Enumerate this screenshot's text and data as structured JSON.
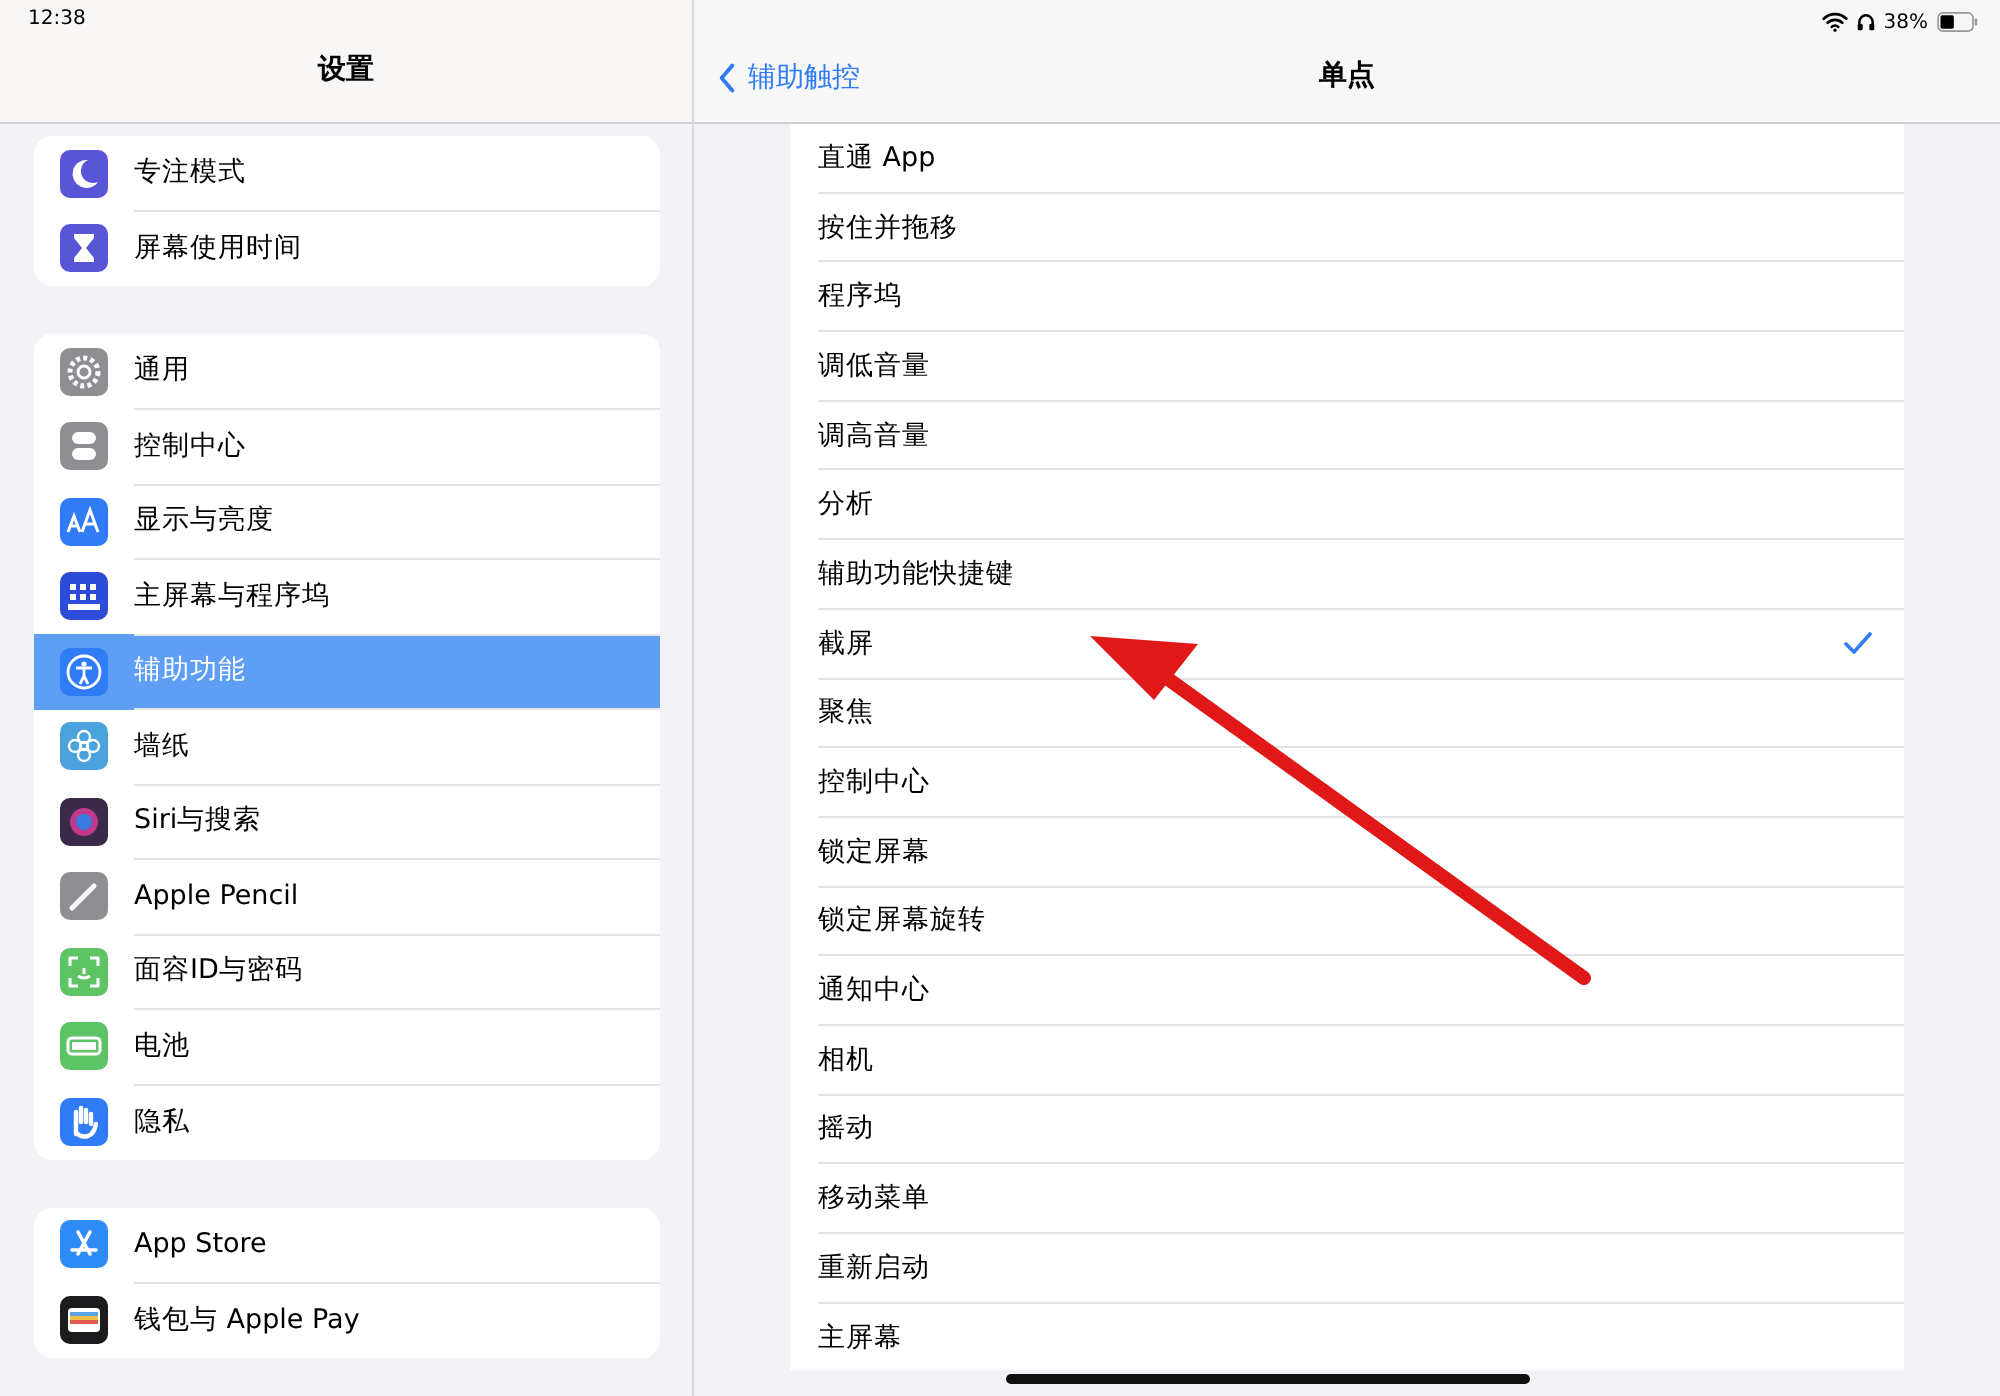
{
  "status_bar": {
    "time": "12:38",
    "battery": "38%"
  },
  "sidebar": {
    "title": "设置",
    "groups": [
      {
        "items": [
          {
            "label": "专注模式",
            "selected": false
          },
          {
            "label": "屏幕使用时间",
            "selected": false
          }
        ]
      },
      {
        "items": [
          {
            "label": "通用",
            "selected": false
          },
          {
            "label": "控制中心",
            "selected": false
          },
          {
            "label": "显示与亮度",
            "selected": false
          },
          {
            "label": "主屏幕与程序坞",
            "selected": false
          },
          {
            "label": "辅助功能",
            "selected": true
          },
          {
            "label": "墙纸",
            "selected": false
          },
          {
            "label": "Siri与搜索",
            "selected": false
          },
          {
            "label": "Apple Pencil",
            "selected": false
          },
          {
            "label": "面容ID与密码",
            "selected": false
          },
          {
            "label": "电池",
            "selected": false
          },
          {
            "label": "隐私",
            "selected": false
          }
        ]
      },
      {
        "items": [
          {
            "label": "App Store",
            "selected": false
          },
          {
            "label": "钱包与 Apple Pay",
            "selected": false
          }
        ]
      }
    ]
  },
  "detail": {
    "back": "辅助触控",
    "title": "单点",
    "options": [
      {
        "label": "直通 App",
        "selected": false
      },
      {
        "label": "按住并拖移",
        "selected": false
      },
      {
        "label": "程序坞",
        "selected": false
      },
      {
        "label": "调低音量",
        "selected": false
      },
      {
        "label": "调高音量",
        "selected": false
      },
      {
        "label": "分析",
        "selected": false
      },
      {
        "label": "辅助功能快捷键",
        "selected": false
      },
      {
        "label": "截屏",
        "selected": true
      },
      {
        "label": "聚焦",
        "selected": false
      },
      {
        "label": "控制中心",
        "selected": false
      },
      {
        "label": "锁定屏幕",
        "selected": false
      },
      {
        "label": "锁定屏幕旋转",
        "selected": false
      },
      {
        "label": "通知中心",
        "selected": false
      },
      {
        "label": "相机",
        "selected": false
      },
      {
        "label": "摇动",
        "selected": false
      },
      {
        "label": "移动菜单",
        "selected": false
      },
      {
        "label": "重新启动",
        "selected": false
      },
      {
        "label": "主屏幕",
        "selected": false
      }
    ]
  }
}
